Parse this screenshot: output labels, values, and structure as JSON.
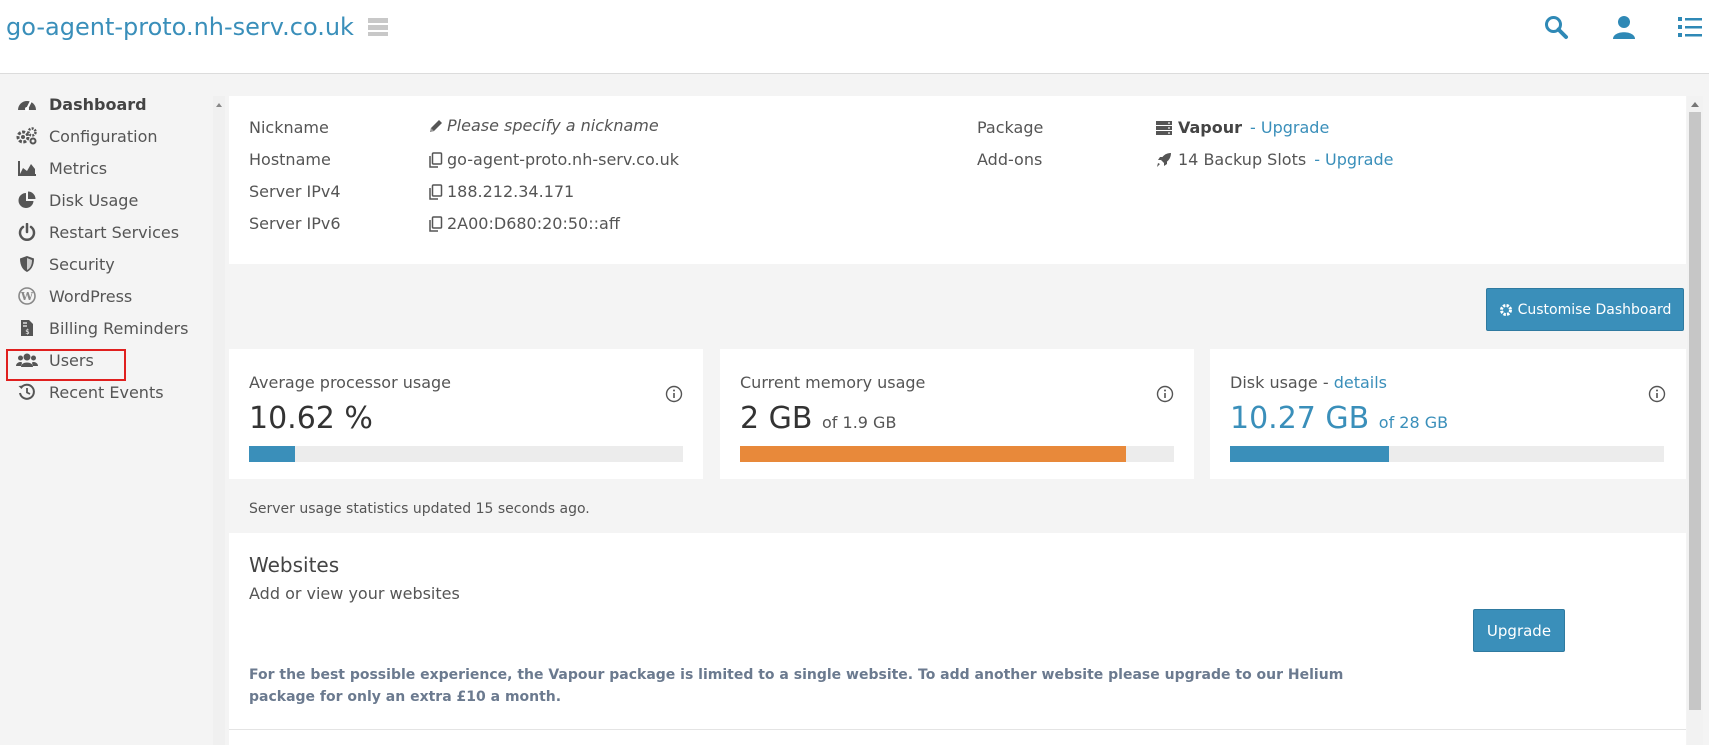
{
  "header": {
    "site_title": "go-agent-proto.nh-serv.co.uk",
    "icons": [
      "server-icon",
      "search-icon",
      "user-icon",
      "menu-list-icon"
    ]
  },
  "sidebar": {
    "items": [
      {
        "label": "Dashboard",
        "icon": "dashboard-icon",
        "active": true
      },
      {
        "label": "Configuration",
        "icon": "cogs-icon"
      },
      {
        "label": "Metrics",
        "icon": "area-chart-icon"
      },
      {
        "label": "Disk Usage",
        "icon": "pie-chart-icon"
      },
      {
        "label": "Restart Services",
        "icon": "power-icon"
      },
      {
        "label": "Security",
        "icon": "shield-icon"
      },
      {
        "label": "WordPress",
        "icon": "wordpress-icon"
      },
      {
        "label": "Billing Reminders",
        "icon": "invoice-icon"
      },
      {
        "label": "Users",
        "icon": "users-icon",
        "highlighted": true
      },
      {
        "label": "Recent Events",
        "icon": "history-icon"
      }
    ]
  },
  "server_info": {
    "nickname_label": "Nickname",
    "nickname_placeholder": "Please specify a nickname",
    "hostname_label": "Hostname",
    "hostname": "go-agent-proto.nh-serv.co.uk",
    "ipv4_label": "Server IPv4",
    "ipv4": "188.212.34.171",
    "ipv6_label": "Server IPv6",
    "ipv6": "2A00:D680:20:50::aff",
    "package_label": "Package",
    "package": "Vapour",
    "package_upgrade": "- Upgrade",
    "addons_label": "Add-ons",
    "addons": "14 Backup Slots",
    "addons_upgrade": "- Upgrade"
  },
  "customise_button": "Customise Dashboard",
  "stats": {
    "cpu": {
      "title": "Average processor usage",
      "value": "10.62 %",
      "of": "",
      "percent": 10.62,
      "color": "#3a8fba"
    },
    "memory": {
      "title": "Current memory usage",
      "value": "2 GB",
      "of": "of 1.9 GB",
      "percent": 89,
      "color": "#e8893a"
    },
    "disk": {
      "title": "Disk usage",
      "title_sep": " - ",
      "title_link": "details",
      "value": "10.27 GB",
      "of": "of 28 GB",
      "percent": 36.7,
      "color": "#3a8fba"
    }
  },
  "updated_text": "Server usage statistics updated 15 seconds ago.",
  "websites": {
    "title": "Websites",
    "subtitle": "Add or view your websites",
    "upgrade_button": "Upgrade",
    "note": "For the best possible experience, the Vapour package is limited to a single website. To add another website please upgrade to our Helium package for only an extra £10 a month."
  }
}
